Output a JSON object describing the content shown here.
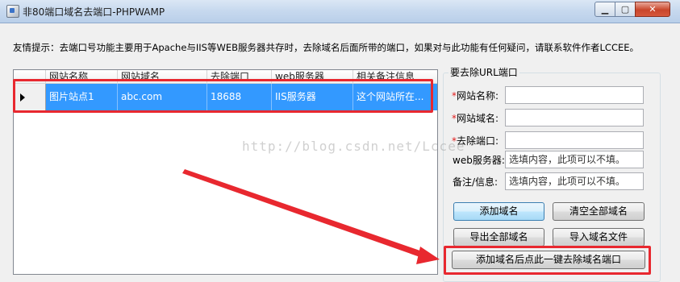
{
  "window": {
    "title": "非80端口域名去端口-PHPWAMP",
    "min_symbol": "▁",
    "max_symbol": "▢",
    "close_symbol": "✕"
  },
  "tip": "友情提示：去端口号功能主要用于Apache与IIS等WEB服务器共存时，去除域名后面所带的端口，如果对与此功能有任何疑问，请联系软件作者LCCEE。",
  "grid": {
    "columns": [
      "网站名称",
      "网站域名",
      "去除端口",
      "web服务器",
      "相关备注信息"
    ],
    "rows": [
      {
        "name": "图片站点1",
        "domain": "abc.com",
        "port": "18688",
        "server": "IIS服务器",
        "note": "这个网站所在..."
      }
    ]
  },
  "watermark": "http://blog.csdn.net/Lccee",
  "panel": {
    "title": "要去除URL端口",
    "fields": [
      {
        "label": "网站名称:",
        "required": true,
        "value": "",
        "placeholder": ""
      },
      {
        "label": "网站域名:",
        "required": true,
        "value": "",
        "placeholder": ""
      },
      {
        "label": "去除端口:",
        "required": true,
        "value": "",
        "placeholder": ""
      },
      {
        "label": "web服务器:",
        "required": false,
        "value": "选填内容，此项可以不填。",
        "placeholder": ""
      },
      {
        "label": "备注/信息:",
        "required": false,
        "value": "选填内容，此项可以不填。",
        "placeholder": ""
      }
    ],
    "required_mark": "*",
    "buttons": {
      "add": "添加域名",
      "clear_all": "清空全部域名",
      "export_all": "导出全部域名",
      "import": "导入域名文件",
      "one_click": "添加域名后点此一键去除域名端口"
    }
  },
  "colors": {
    "selection": "#3399ff",
    "annotation_red": "#e8282f"
  }
}
